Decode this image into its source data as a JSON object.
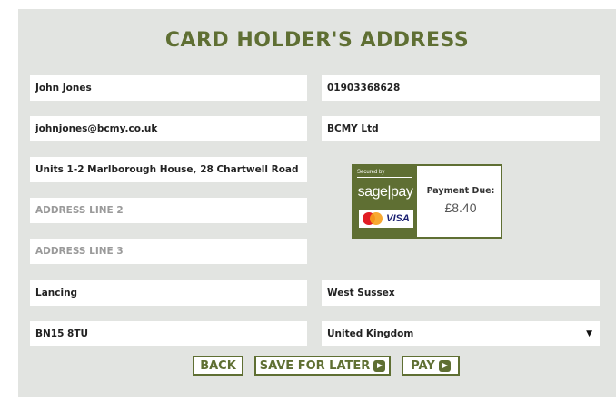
{
  "title": "CARD HOLDER'S ADDRESS",
  "fields": {
    "name": {
      "value": "John Jones",
      "placeholder": ""
    },
    "phone": {
      "value": "01903368628",
      "placeholder": ""
    },
    "email": {
      "value": "johnjones@bcmy.co.uk",
      "placeholder": ""
    },
    "company": {
      "value": "BCMY Ltd",
      "placeholder": ""
    },
    "address1": {
      "value": "Units 1-2 Marlborough House, 28 Chartwell Road",
      "placeholder": ""
    },
    "address2": {
      "value": "",
      "placeholder": "ADDRESS LINE 2"
    },
    "address3": {
      "value": "",
      "placeholder": "ADDRESS LINE 3"
    },
    "town": {
      "value": "Lancing",
      "placeholder": ""
    },
    "county": {
      "value": "West Sussex",
      "placeholder": ""
    },
    "postcode": {
      "value": "BN15 8TU",
      "placeholder": ""
    },
    "country": {
      "value": "United Kingdom",
      "arrow": "▼"
    }
  },
  "payment": {
    "secured_by": "Secured by",
    "brand": "sage|pay",
    "card_visa": "VISA",
    "due_label": "Payment Due:",
    "due_amount": "£8.40"
  },
  "buttons": {
    "back": "BACK",
    "save_for_later": "SAVE FOR LATER",
    "pay": "PAY"
  },
  "colors": {
    "accent": "#5f6f33",
    "panel_bg": "#e2e4e1"
  }
}
